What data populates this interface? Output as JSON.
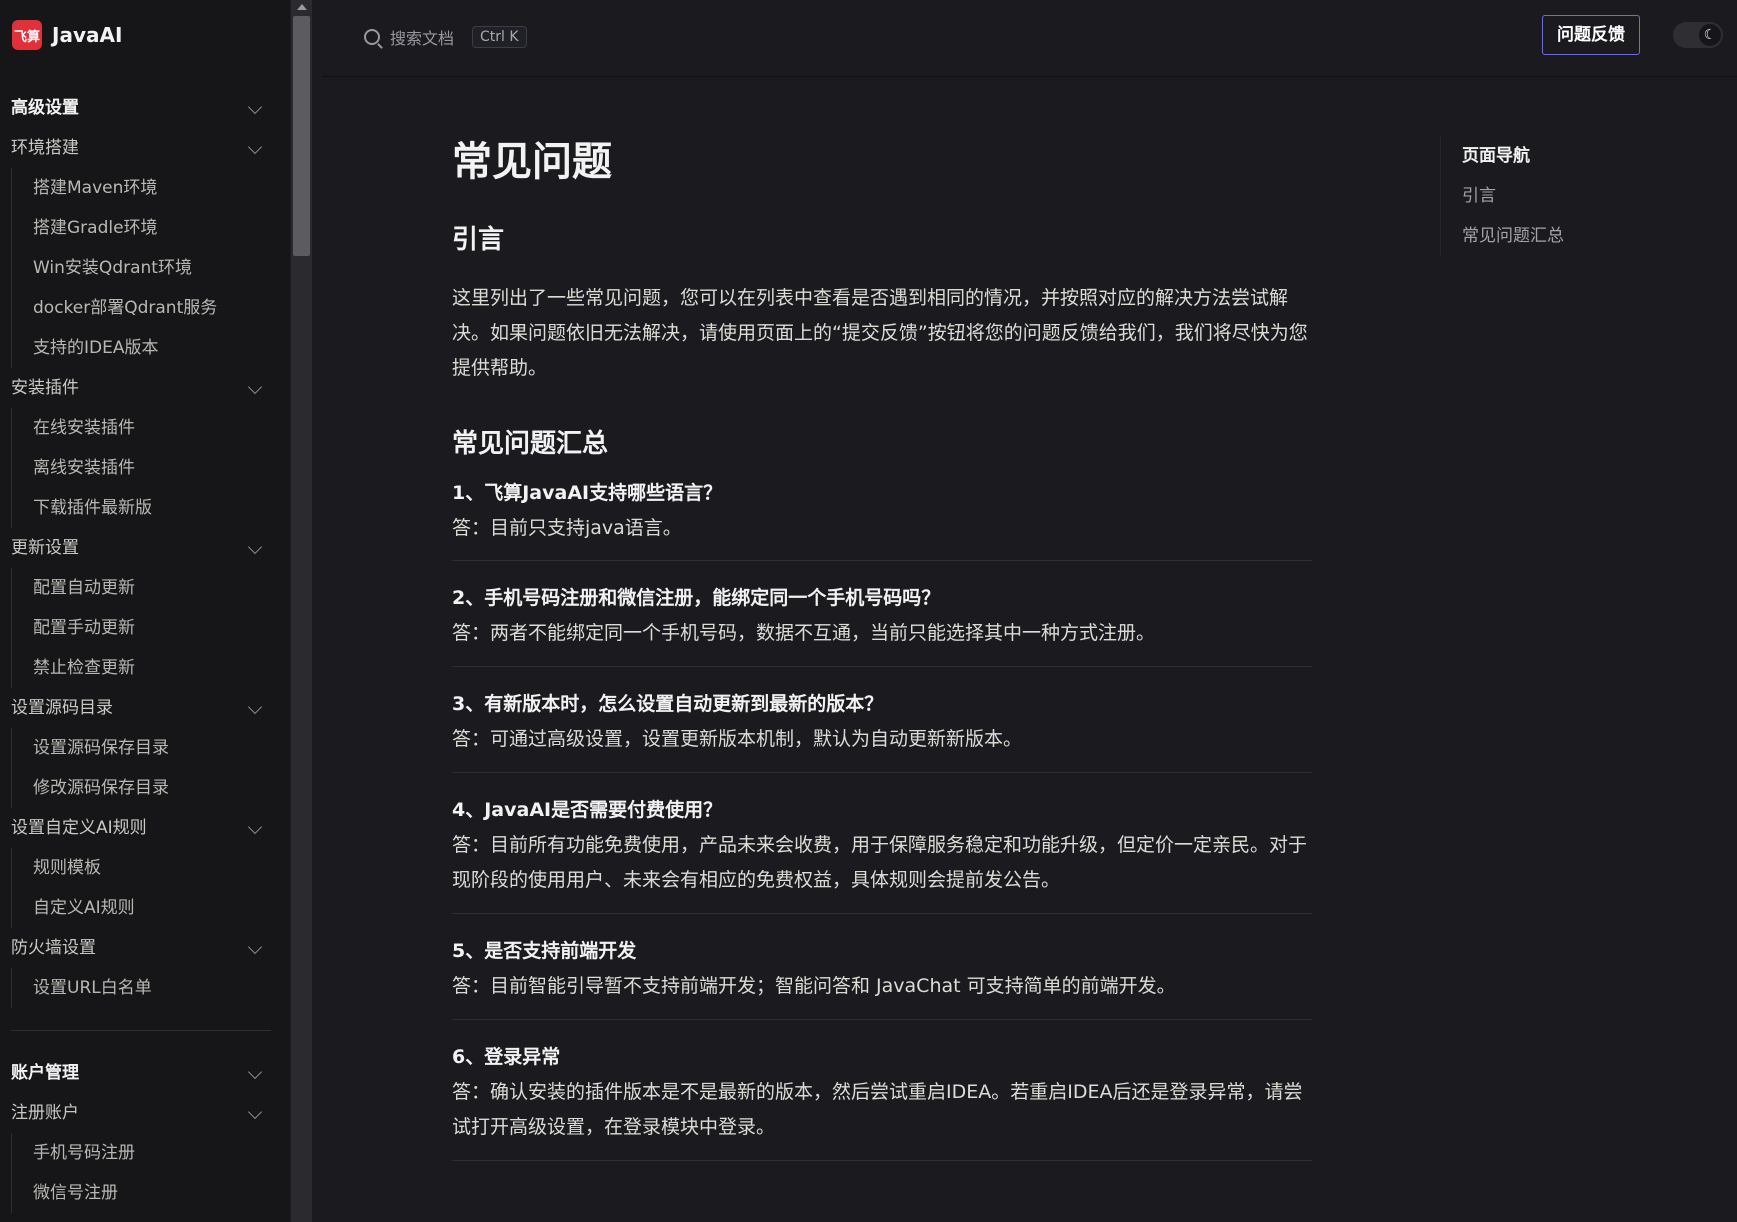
{
  "brand": {
    "logo_text": "飞算",
    "name": "JavaAI"
  },
  "sidebar": {
    "groups": [
      {
        "title": "高级设置",
        "sections": [
          {
            "title": "环境搭建",
            "items": [
              "搭建Maven环境",
              "搭建Gradle环境",
              "Win安装Qdrant环境",
              "docker部署Qdrant服务",
              "支持的IDEA版本"
            ]
          },
          {
            "title": "安装插件",
            "items": [
              "在线安装插件",
              "离线安装插件",
              "下载插件最新版"
            ]
          },
          {
            "title": "更新设置",
            "items": [
              "配置自动更新",
              "配置手动更新",
              "禁止检查更新"
            ]
          },
          {
            "title": "设置源码目录",
            "items": [
              "设置源码保存目录",
              "修改源码保存目录"
            ]
          },
          {
            "title": "设置自定义AI规则",
            "items": [
              "规则模板",
              "自定义AI规则"
            ]
          },
          {
            "title": "防火墙设置",
            "items": [
              "设置URL白名单"
            ]
          }
        ]
      },
      {
        "title": "账户管理",
        "sections": [
          {
            "title": "注册账户",
            "items": [
              "手机号码注册",
              "微信号注册"
            ]
          }
        ]
      }
    ]
  },
  "topbar": {
    "search_placeholder": "搜索文档",
    "search_shortcut": "Ctrl K",
    "feedback_label": "问题反馈",
    "theme_icon": "moon-icon"
  },
  "main": {
    "title": "常见问题",
    "sections": [
      {
        "heading": "引言",
        "intro": "这里列出了一些常见问题，您可以在列表中查看是否遇到相同的情况，并按照对应的解决方法尝试解决。如果问题依旧无法解决，请使用页面上的“提交反馈”按钮将您的问题反馈给我们，我们将尽快为您提供帮助。"
      },
      {
        "heading": "常见问题汇总",
        "faqs": [
          {
            "q": "1、飞算JavaAI支持哪些语言？",
            "a": "答：目前只支持java语言。"
          },
          {
            "q": "2、手机号码注册和微信注册，能绑定同一个手机号码吗？",
            "a": "答：两者不能绑定同一个手机号码，数据不互通，当前只能选择其中一种方式注册。"
          },
          {
            "q": "3、有新版本时，怎么设置自动更新到最新的版本？",
            "a": "答：可通过高级设置，设置更新版本机制，默认为自动更新新版本。"
          },
          {
            "q": "4、JavaAI是否需要付费使用？",
            "a": "答：目前所有功能免费使用，产品未来会收费，用于保障服务稳定和功能升级，但定价一定亲民。对于现阶段的使用用户、未来会有相应的免费权益，具体规则会提前发公告。"
          },
          {
            "q": "5、是否支持前端开发",
            "a": "答：目前智能引导暂不支持前端开发；智能问答和 JavaChat 可支持简单的前端开发。"
          },
          {
            "q": "6、登录异常",
            "a": "答：确认安装的插件版本是不是最新的版本，然后尝试重启IDEA。若重启IDEA后还是登录异常，请尝试打开高级设置，在登录模块中登录。"
          }
        ]
      }
    ]
  },
  "outline": {
    "title": "页面导航",
    "items": [
      "引言",
      "常见问题汇总"
    ]
  }
}
